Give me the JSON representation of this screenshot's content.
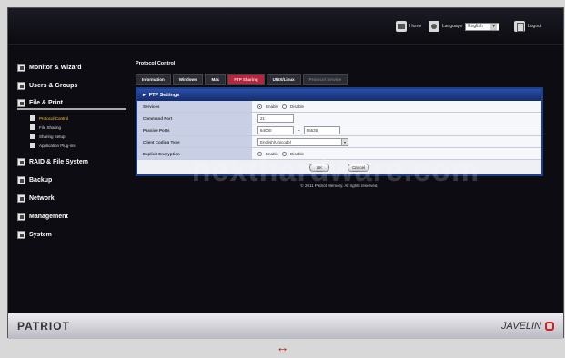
{
  "topbar": {
    "home_label": "Home",
    "language_label": "Language",
    "language_value": "English",
    "logout_label": "Logout"
  },
  "sidebar": {
    "items": [
      {
        "label": "Monitor & Wizard"
      },
      {
        "label": "Users & Groups"
      },
      {
        "label": "File & Print"
      },
      {
        "label": "RAID & File System"
      },
      {
        "label": "Backup"
      },
      {
        "label": "Network"
      },
      {
        "label": "Management"
      },
      {
        "label": "System"
      }
    ],
    "subitems": [
      {
        "label": "Protocol Control",
        "active": true
      },
      {
        "label": "File Sharing"
      },
      {
        "label": "Sharing Setup"
      },
      {
        "label": "Application Plug-ins"
      }
    ]
  },
  "main": {
    "title": "Protocol Control",
    "tabs": [
      {
        "label": "Information"
      },
      {
        "label": "Windows"
      },
      {
        "label": "Mac"
      },
      {
        "label": "FTP Sharing"
      },
      {
        "label": "UNIX/Linux"
      },
      {
        "label": "Protocol Service"
      }
    ],
    "panel_title": "FTP Settings",
    "rows": {
      "services": {
        "label": "Services",
        "enable": "Enable",
        "disable": "Disable"
      },
      "command_port": {
        "label": "Command Port",
        "value": "21"
      },
      "passive_ports": {
        "label": "Passive Ports",
        "from": "64000",
        "sep": "~",
        "to": "65535"
      },
      "client_coding": {
        "label": "Client Coding Type",
        "value": "English(Unicode)"
      },
      "explicit": {
        "label": "Explicit Encryption",
        "enable": "Enable",
        "disable": "Disable"
      }
    },
    "ok_label": "OK",
    "cancel_label": "Cancel",
    "copyright": "© 2011 Patriot Memory. All rights reserved."
  },
  "watermark": "nexthardware.com",
  "footer": {
    "brand_left": "PATRIOT",
    "brand_right": "JAVELIN"
  },
  "expand_glyph": "↔",
  "colors": {
    "accent_tab": "#b2283f",
    "panel_header": "#2b4fa8",
    "active_subitem": "#ffcc33"
  }
}
